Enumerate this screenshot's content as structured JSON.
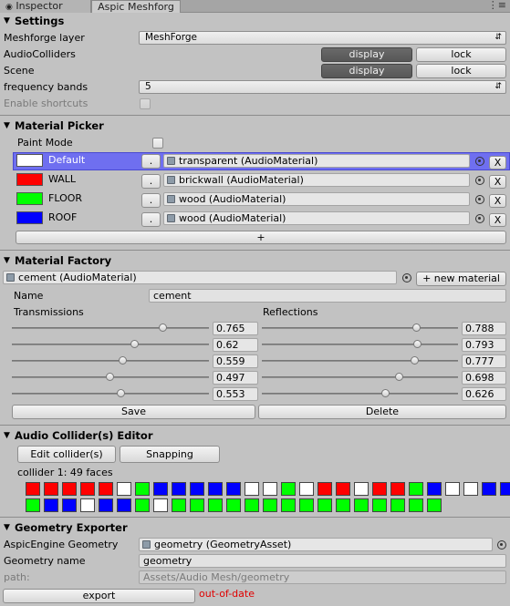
{
  "tabs": {
    "inspector": "Inspector",
    "meshforge": "Aspic Meshforg",
    "menu": "⋮≡"
  },
  "settings": {
    "title": "Settings",
    "meshforge_layer_label": "Meshforge layer",
    "meshforge_layer_value": "MeshForge",
    "audiocolliders_label": "AudioColliders",
    "scene_label": "Scene",
    "display_label": "display",
    "lock_label": "lock",
    "frequency_label": "frequency bands",
    "frequency_value": "5",
    "shortcuts_label": "Enable shortcuts"
  },
  "picker": {
    "title": "Material Picker",
    "paint_mode_label": "Paint Mode",
    "dot_label": ".",
    "remove_label": "X",
    "add_label": "+",
    "rows": [
      {
        "name": "Default",
        "color": "#ffffff",
        "material": "transparent (AudioMaterial)"
      },
      {
        "name": "WALL",
        "color": "#ff0000",
        "material": "brickwall (AudioMaterial)"
      },
      {
        "name": "FLOOR",
        "color": "#00ff00",
        "material": "wood (AudioMaterial)"
      },
      {
        "name": "ROOF",
        "color": "#0000ff",
        "material": "wood (AudioMaterial)"
      }
    ]
  },
  "factory": {
    "title": "Material Factory",
    "material": "cement (AudioMaterial)",
    "new_material_label": "+ new material",
    "name_label": "Name",
    "name_value": "cement",
    "transmissions_label": "Transmissions",
    "reflections_label": "Reflections",
    "transmissions": [
      "0.765",
      "0.62",
      "0.559",
      "0.497",
      "0.553"
    ],
    "reflections": [
      "0.788",
      "0.793",
      "0.777",
      "0.698",
      "0.626"
    ],
    "save_label": "Save",
    "delete_label": "Delete"
  },
  "collider": {
    "title": "Audio Collider(s) Editor",
    "edit_label": "Edit collider(s)",
    "snapping_label": "Snapping",
    "summary": "collider 1: 49 faces",
    "faces": [
      "#ff0000",
      "#ff0000",
      "#ff0000",
      "#ff0000",
      "#ff0000",
      "#ffffff",
      "#00ff00",
      "#0000ff",
      "#0000ff",
      "#0000ff",
      "#0000ff",
      "#0000ff",
      "#ffffff",
      "#ffffff",
      "#00ff00",
      "#ffffff",
      "#ff0000",
      "#ff0000",
      "#ffffff",
      "#ff0000",
      "#ff0000",
      "#00ff00",
      "#0000ff",
      "#ffffff",
      "#ffffff",
      "#0000ff",
      "#0000ff",
      "#00ff00",
      "#0000ff",
      "#0000ff",
      "#ffffff",
      "#0000ff",
      "#0000ff",
      "#00ff00",
      "#ffffff",
      "#00ff00",
      "#00ff00",
      "#00ff00",
      "#00ff00",
      "#00ff00",
      "#00ff00",
      "#00ff00",
      "#00ff00",
      "#00ff00",
      "#00ff00",
      "#00ff00",
      "#00ff00",
      "#00ff00",
      "#00ff00",
      "#00ff00"
    ]
  },
  "exporter": {
    "title": "Geometry Exporter",
    "geometry_label": "AspicEngine Geometry",
    "geometry_value": "geometry (GeometryAsset)",
    "name_label": "Geometry name",
    "name_value": "geometry",
    "path_label": "path:",
    "path_value": "Assets/Audio Mesh/geometry",
    "export_label": "export",
    "status": "out-of-date"
  },
  "colors": {
    "selection": "#6f6ff0",
    "status": "#e00000"
  }
}
